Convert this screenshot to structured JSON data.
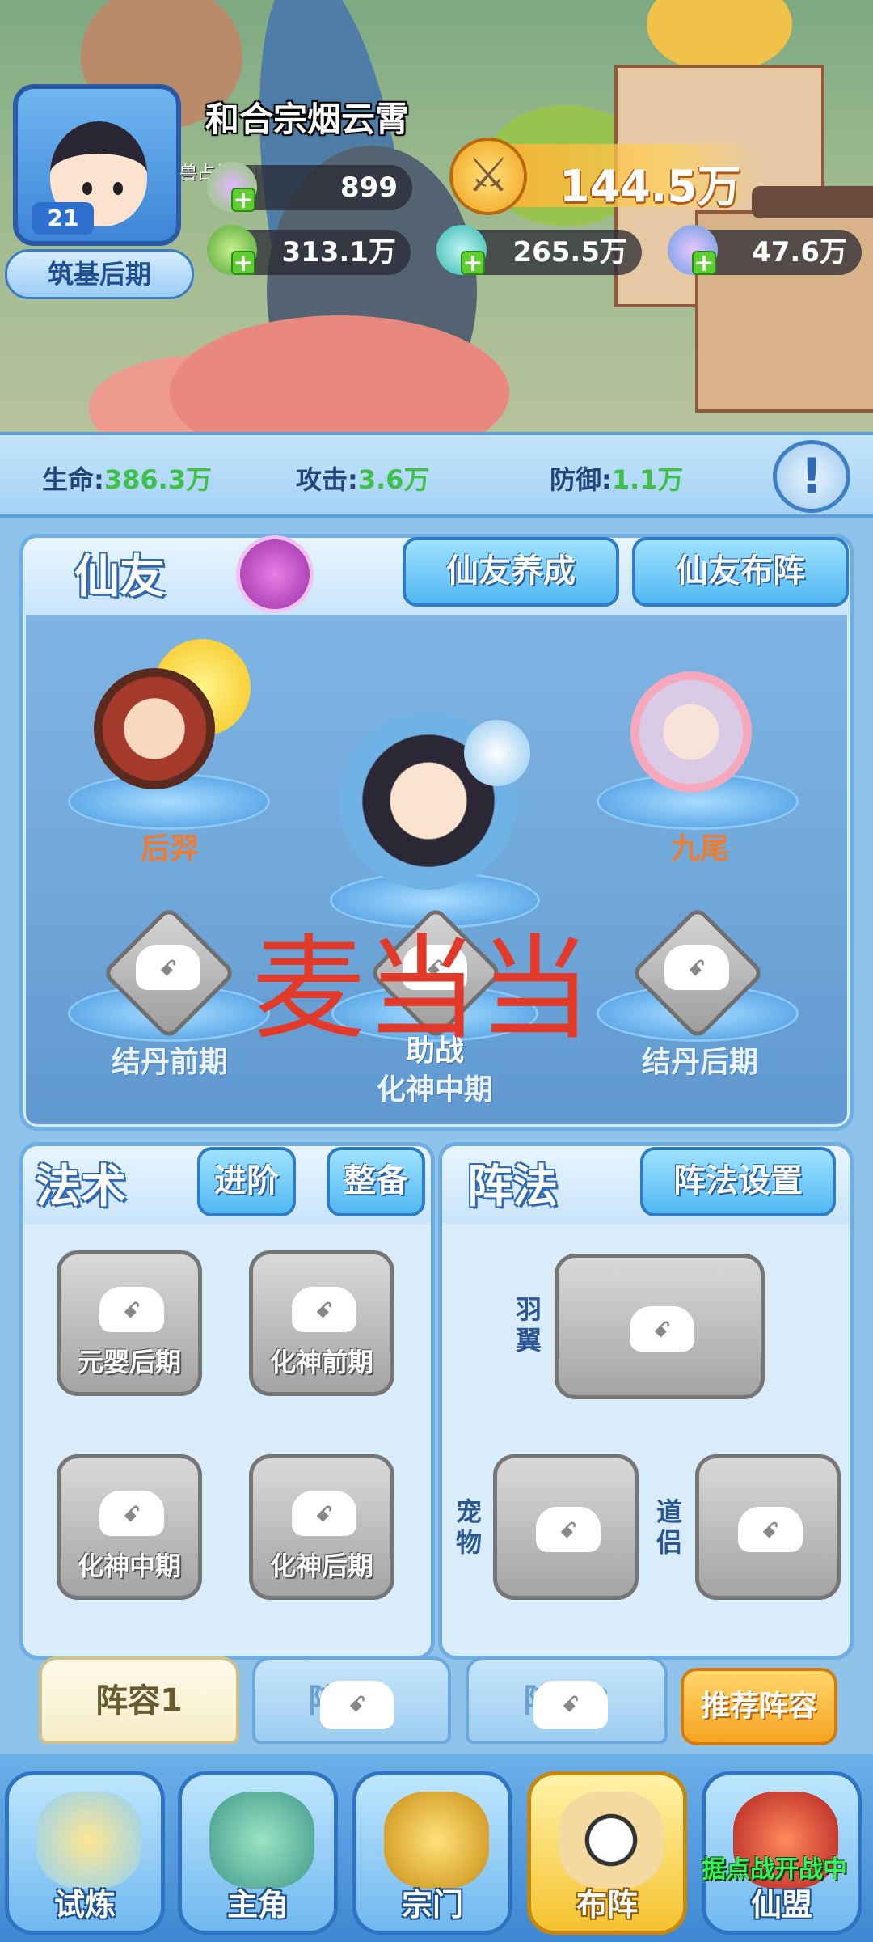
{
  "header": {
    "player_name": "和合宗烟云霄",
    "sub_status": "兽占领中)",
    "level": "21",
    "realm": "筑基后期",
    "power": "144.5万",
    "resources": [
      {
        "icon": "spirit-orb-icon",
        "value": "899"
      },
      {
        "icon": "jade-leaf-icon",
        "value": "313.1万"
      },
      {
        "icon": "crystal-icon",
        "value": "265.5万"
      },
      {
        "icon": "fan-feather-icon",
        "value": "47.6万"
      }
    ]
  },
  "stats": {
    "hp_label": "生命:",
    "hp_value": "386.3万",
    "atk_label": "攻击:",
    "atk_value": "3.6万",
    "def_label": "防御:",
    "def_value": "1.1万",
    "info_glyph": "!"
  },
  "xianyou": {
    "title": "仙友",
    "btn_cultivate": "仙友养成",
    "btn_formation": "仙友布阵",
    "companions": [
      "后羿",
      "九尾"
    ],
    "support_label": "助战",
    "locked_slots": [
      "结丹前期",
      "化神中期",
      "结丹后期"
    ],
    "watermark": "麦当当"
  },
  "fashu": {
    "title": "法术",
    "btn_advance": "进阶",
    "btn_equip": "整备",
    "slots": [
      "元婴后期",
      "化神前期",
      "化神中期",
      "化神后期"
    ]
  },
  "zhenfa": {
    "title": "阵法",
    "btn_settings": "阵法设置",
    "wing_label": "羽翼",
    "pet_label": "宠物",
    "partner_label": "道侣"
  },
  "tabs": [
    "阵容1",
    "阵容2",
    "阵容3"
  ],
  "recommend": "推荐阵容",
  "bottom_nav": [
    "试炼",
    "主角",
    "宗门",
    "布阵",
    "仙盟"
  ],
  "alliance_badge": "据点战开战中",
  "colors": {
    "accent_blue": "#2e7cc7",
    "stat_green": "#3fc04a",
    "power_orange": "#f1a21e",
    "companion_orange": "#f07a2e",
    "watermark_red": "#e23a2a",
    "badge_green": "#39f25a"
  }
}
